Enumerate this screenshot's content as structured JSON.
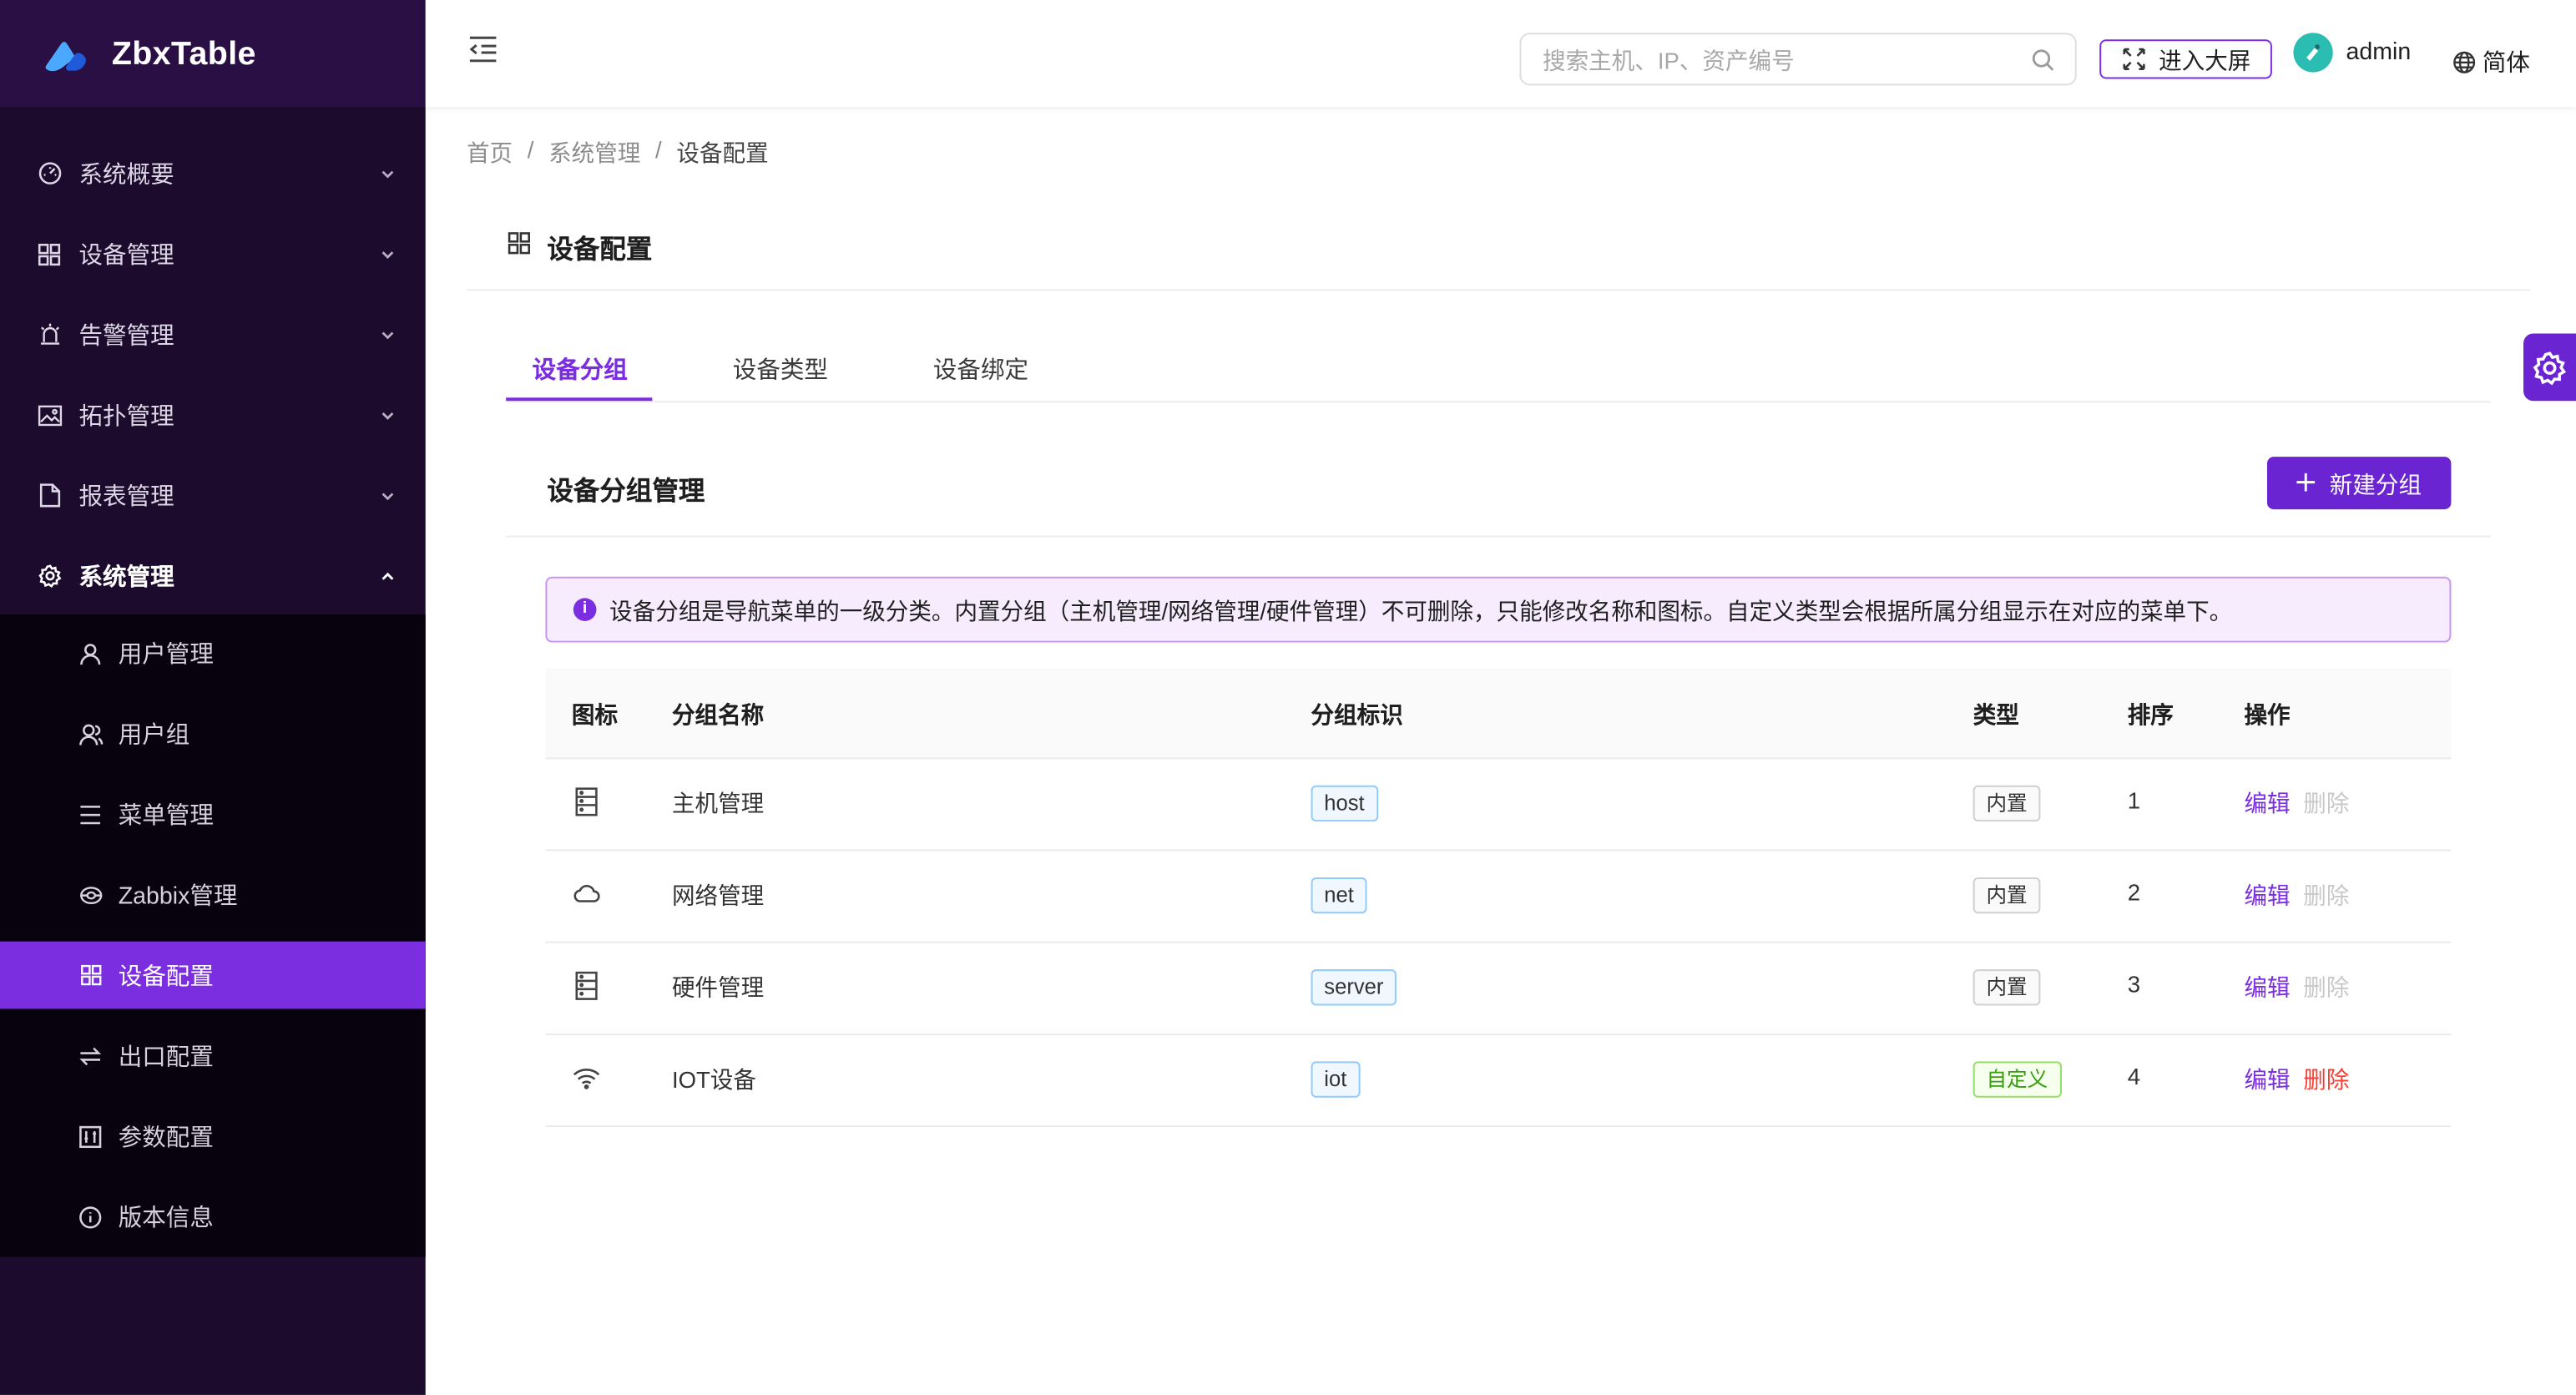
{
  "app": {
    "name": "ZbxTable"
  },
  "sidebar": {
    "items": [
      {
        "label": "系统概要",
        "icon": "dashboard-icon"
      },
      {
        "label": "设备管理",
        "icon": "grid-icon"
      },
      {
        "label": "告警管理",
        "icon": "alarm-icon"
      },
      {
        "label": "拓扑管理",
        "icon": "image-icon"
      },
      {
        "label": "报表管理",
        "icon": "file-icon"
      },
      {
        "label": "系统管理",
        "icon": "gear-icon"
      }
    ],
    "submenu": [
      {
        "label": "用户管理",
        "icon": "user-icon"
      },
      {
        "label": "用户组",
        "icon": "users-icon"
      },
      {
        "label": "菜单管理",
        "icon": "menu-icon"
      },
      {
        "label": "Zabbix管理",
        "icon": "zabbix-icon"
      },
      {
        "label": "设备配置",
        "icon": "grid-icon"
      },
      {
        "label": "出口配置",
        "icon": "swap-icon"
      },
      {
        "label": "参数配置",
        "icon": "sliders-icon"
      },
      {
        "label": "版本信息",
        "icon": "info-icon"
      }
    ]
  },
  "header": {
    "search_placeholder": "搜索主机、IP、资产编号",
    "bigscreen_label": "进入大屏",
    "username": "admin",
    "language": "简体"
  },
  "breadcrumb": {
    "home": "首页",
    "parent": "系统管理",
    "current": "设备配置"
  },
  "page": {
    "title": "设备配置"
  },
  "tabs": [
    "设备分组",
    "设备类型",
    "设备绑定"
  ],
  "section": {
    "title": "设备分组管理",
    "new_button": "新建分组",
    "alert": "设备分组是导航菜单的一级分类。内置分组（主机管理/网络管理/硬件管理）不可删除，只能修改名称和图标。自定义类型会根据所属分组显示在对应的菜单下。"
  },
  "table": {
    "headers": {
      "icon": "图标",
      "name": "分组名称",
      "code": "分组标识",
      "type": "类型",
      "order": "排序",
      "actions": "操作"
    },
    "rows": [
      {
        "icon": "server-icon",
        "name": "主机管理",
        "code": "host",
        "type": "内置",
        "order": "1",
        "edit": "编辑",
        "delete": "删除"
      },
      {
        "icon": "cloud-icon",
        "name": "网络管理",
        "code": "net",
        "type": "内置",
        "order": "2",
        "edit": "编辑",
        "delete": "删除"
      },
      {
        "icon": "server-icon",
        "name": "硬件管理",
        "code": "server",
        "type": "内置",
        "order": "3",
        "edit": "编辑",
        "delete": "删除"
      },
      {
        "icon": "wifi-icon",
        "name": "IOT设备",
        "code": "iot",
        "type": "自定义",
        "order": "4",
        "edit": "编辑",
        "delete": "删除"
      }
    ]
  },
  "colors": {
    "primary": "#7b2ee0",
    "sidebar_bg": "#1c0b2c",
    "danger": "#ff3b30"
  }
}
